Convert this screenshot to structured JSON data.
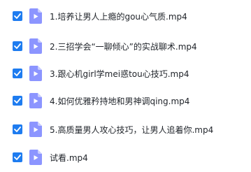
{
  "files": [
    {
      "name": "1.培养让男人上瘾的gou心气质.mp4",
      "checked": true,
      "icon": "video-file-icon"
    },
    {
      "name": "2.三招学会“一聊倾心”的实战聊术.mp4",
      "checked": true,
      "icon": "video-file-icon"
    },
    {
      "name": "3.跟心机girl学mei惑tou心技巧.mp4",
      "checked": true,
      "icon": "video-file-icon"
    },
    {
      "name": "4.如何优雅矜持地和男神调qing.mp4",
      "checked": true,
      "icon": "video-file-icon"
    },
    {
      "name": "5.高质量男人攻心技巧，让男人追着你.mp4",
      "checked": true,
      "icon": "video-file-icon"
    },
    {
      "name": "试看.mp4",
      "checked": true,
      "icon": "video-file-icon"
    }
  ],
  "colors": {
    "checkbox": "#1e7cf0",
    "icon_body": "#8c95ff",
    "icon_fold": "#c9cdff",
    "text": "#1f2329"
  }
}
